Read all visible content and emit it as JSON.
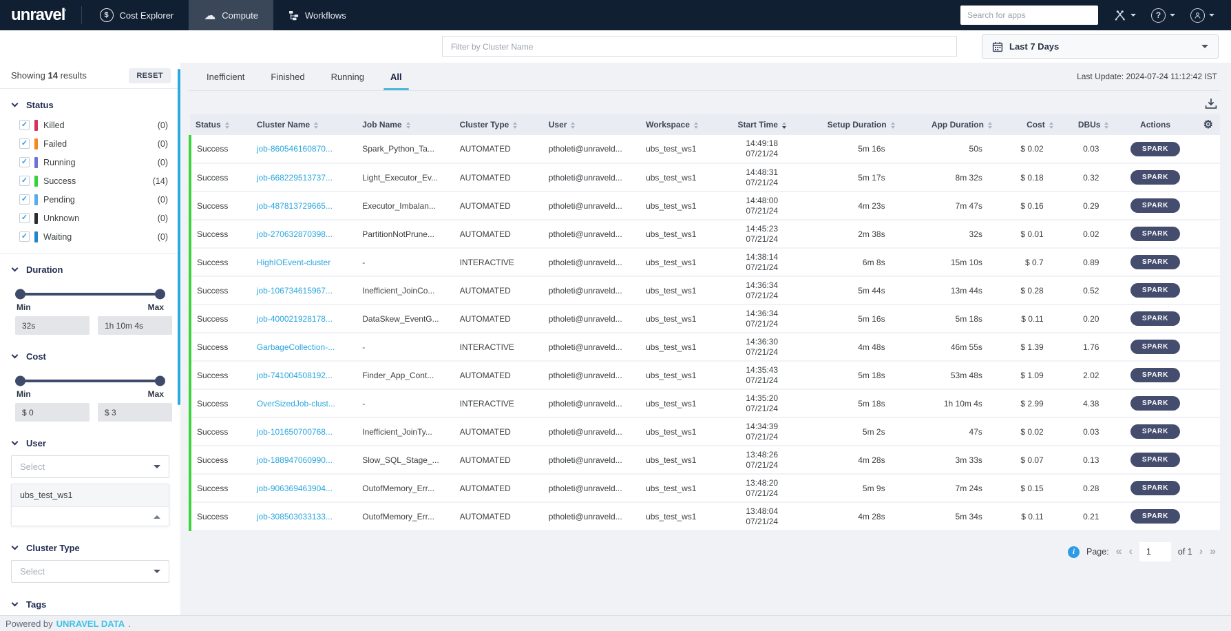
{
  "navbar": {
    "logo_text": "unravel",
    "items": [
      {
        "label": "Cost Explorer",
        "icon": "dollar-circle-icon"
      },
      {
        "label": "Compute",
        "icon": "compute-cloud-icon",
        "active": true
      },
      {
        "label": "Workflows",
        "icon": "workflows-icon"
      }
    ],
    "search_placeholder": "Search for apps"
  },
  "icons": {
    "dollar": "$",
    "cloud": "☁",
    "help": "?",
    "gear": "⚙",
    "check": "✓",
    "info": "i",
    "pagination_first": "«",
    "pagination_prev": "‹",
    "pagination_next": "›",
    "pagination_last": "»"
  },
  "filter_bar": {
    "cluster_filter_placeholder": "Filter by Cluster Name",
    "date_range": "Last 7 Days"
  },
  "sidebar": {
    "showing_prefix": "Showing",
    "result_count": "14",
    "showing_suffix": "results",
    "reset_label": "RESET",
    "status": {
      "title": "Status",
      "items": [
        {
          "label": "Killed",
          "count": "(0)",
          "color": "#d6325f"
        },
        {
          "label": "Failed",
          "count": "(0)",
          "color": "#f6871f"
        },
        {
          "label": "Running",
          "count": "(0)",
          "color": "#6b74d6"
        },
        {
          "label": "Success",
          "count": "(14)",
          "color": "#35d435"
        },
        {
          "label": "Pending",
          "count": "(0)",
          "color": "#5aabec"
        },
        {
          "label": "Unknown",
          "count": "(0)",
          "color": "#2b2b31"
        },
        {
          "label": "Waiting",
          "count": "(0)",
          "color": "#2186cd"
        }
      ]
    },
    "duration": {
      "title": "Duration",
      "min_label": "Min",
      "max_label": "Max",
      "min_value": "32s",
      "max_value": "1h 10m 4s"
    },
    "cost": {
      "title": "Cost",
      "min_label": "Min",
      "max_label": "Max",
      "min_value": "$ 0",
      "max_value": "$ 3"
    },
    "user": {
      "title": "User",
      "placeholder": "Select",
      "dropdown_item": "ubs_test_ws1"
    },
    "cluster_type": {
      "title": "Cluster Type",
      "placeholder": "Select"
    },
    "tags": {
      "title": "Tags"
    }
  },
  "main": {
    "tabs": [
      {
        "label": "Inefficient"
      },
      {
        "label": "Finished"
      },
      {
        "label": "Running"
      },
      {
        "label": "All",
        "active": true
      }
    ],
    "last_update": "Last Update: 2024-07-24 11:12:42 IST",
    "table": {
      "columns": [
        "Status",
        "Cluster Name",
        "Job Name",
        "Cluster Type",
        "User",
        "Workspace",
        "Start Time",
        "Setup Duration",
        "App Duration",
        "Cost",
        "DBUs",
        "Actions"
      ],
      "rows": [
        {
          "status": "Success",
          "cluster_name": "job-860546160870...",
          "job_name": "Spark_Python_Ta...",
          "cluster_type": "AUTOMATED",
          "user": "ptholeti@unraveld...",
          "workspace": "ubs_test_ws1",
          "start_time": "14:49:18",
          "start_date": "07/21/24",
          "setup_duration": "5m 16s",
          "app_duration": "50s",
          "cost": "$ 0.02",
          "dbus": "0.03",
          "action": "SPARK"
        },
        {
          "status": "Success",
          "cluster_name": "job-668229513737...",
          "job_name": "Light_Executor_Ev...",
          "cluster_type": "AUTOMATED",
          "user": "ptholeti@unraveld...",
          "workspace": "ubs_test_ws1",
          "start_time": "14:48:31",
          "start_date": "07/21/24",
          "setup_duration": "5m 17s",
          "app_duration": "8m 32s",
          "cost": "$ 0.18",
          "dbus": "0.32",
          "action": "SPARK"
        },
        {
          "status": "Success",
          "cluster_name": "job-487813729665...",
          "job_name": "Executor_Imbalan...",
          "cluster_type": "AUTOMATED",
          "user": "ptholeti@unraveld...",
          "workspace": "ubs_test_ws1",
          "start_time": "14:48:00",
          "start_date": "07/21/24",
          "setup_duration": "4m 23s",
          "app_duration": "7m 47s",
          "cost": "$ 0.16",
          "dbus": "0.29",
          "action": "SPARK"
        },
        {
          "status": "Success",
          "cluster_name": "job-270632870398...",
          "job_name": "PartitionNotPrune...",
          "cluster_type": "AUTOMATED",
          "user": "ptholeti@unraveld...",
          "workspace": "ubs_test_ws1",
          "start_time": "14:45:23",
          "start_date": "07/21/24",
          "setup_duration": "2m 38s",
          "app_duration": "32s",
          "cost": "$ 0.01",
          "dbus": "0.02",
          "action": "SPARK"
        },
        {
          "status": "Success",
          "cluster_name": "HighIOEvent-cluster",
          "job_name": "-",
          "cluster_type": "INTERACTIVE",
          "user": "ptholeti@unraveld...",
          "workspace": "ubs_test_ws1",
          "start_time": "14:38:14",
          "start_date": "07/21/24",
          "setup_duration": "6m 8s",
          "app_duration": "15m 10s",
          "cost": "$ 0.7",
          "dbus": "0.89",
          "action": "SPARK"
        },
        {
          "status": "Success",
          "cluster_name": "job-106734615967...",
          "job_name": "Inefficient_JoinCo...",
          "cluster_type": "AUTOMATED",
          "user": "ptholeti@unraveld...",
          "workspace": "ubs_test_ws1",
          "start_time": "14:36:34",
          "start_date": "07/21/24",
          "setup_duration": "5m 44s",
          "app_duration": "13m 44s",
          "cost": "$ 0.28",
          "dbus": "0.52",
          "action": "SPARK"
        },
        {
          "status": "Success",
          "cluster_name": "job-400021928178...",
          "job_name": "DataSkew_EventG...",
          "cluster_type": "AUTOMATED",
          "user": "ptholeti@unraveld...",
          "workspace": "ubs_test_ws1",
          "start_time": "14:36:34",
          "start_date": "07/21/24",
          "setup_duration": "5m 16s",
          "app_duration": "5m 18s",
          "cost": "$ 0.11",
          "dbus": "0.20",
          "action": "SPARK"
        },
        {
          "status": "Success",
          "cluster_name": "GarbageCollection-...",
          "job_name": "-",
          "cluster_type": "INTERACTIVE",
          "user": "ptholeti@unraveld...",
          "workspace": "ubs_test_ws1",
          "start_time": "14:36:30",
          "start_date": "07/21/24",
          "setup_duration": "4m 48s",
          "app_duration": "46m 55s",
          "cost": "$ 1.39",
          "dbus": "1.76",
          "action": "SPARK"
        },
        {
          "status": "Success",
          "cluster_name": "job-741004508192...",
          "job_name": "Finder_App_Cont...",
          "cluster_type": "AUTOMATED",
          "user": "ptholeti@unraveld...",
          "workspace": "ubs_test_ws1",
          "start_time": "14:35:43",
          "start_date": "07/21/24",
          "setup_duration": "5m 18s",
          "app_duration": "53m 48s",
          "cost": "$ 1.09",
          "dbus": "2.02",
          "action": "SPARK"
        },
        {
          "status": "Success",
          "cluster_name": "OverSizedJob-clust...",
          "job_name": "-",
          "cluster_type": "INTERACTIVE",
          "user": "ptholeti@unraveld...",
          "workspace": "ubs_test_ws1",
          "start_time": "14:35:20",
          "start_date": "07/21/24",
          "setup_duration": "5m 18s",
          "app_duration": "1h 10m 4s",
          "cost": "$ 2.99",
          "dbus": "4.38",
          "action": "SPARK"
        },
        {
          "status": "Success",
          "cluster_name": "job-101650700768...",
          "job_name": "Inefficient_JoinTy...",
          "cluster_type": "AUTOMATED",
          "user": "ptholeti@unraveld...",
          "workspace": "ubs_test_ws1",
          "start_time": "14:34:39",
          "start_date": "07/21/24",
          "setup_duration": "5m 2s",
          "app_duration": "47s",
          "cost": "$ 0.02",
          "dbus": "0.03",
          "action": "SPARK"
        },
        {
          "status": "Success",
          "cluster_name": "job-188947060990...",
          "job_name": "Slow_SQL_Stage_...",
          "cluster_type": "AUTOMATED",
          "user": "ptholeti@unraveld...",
          "workspace": "ubs_test_ws1",
          "start_time": "13:48:26",
          "start_date": "07/21/24",
          "setup_duration": "4m 28s",
          "app_duration": "3m 33s",
          "cost": "$ 0.07",
          "dbus": "0.13",
          "action": "SPARK"
        },
        {
          "status": "Success",
          "cluster_name": "job-906369463904...",
          "job_name": "OutofMemory_Err...",
          "cluster_type": "AUTOMATED",
          "user": "ptholeti@unraveld...",
          "workspace": "ubs_test_ws1",
          "start_time": "13:48:20",
          "start_date": "07/21/24",
          "setup_duration": "5m 9s",
          "app_duration": "7m 24s",
          "cost": "$ 0.15",
          "dbus": "0.28",
          "action": "SPARK"
        },
        {
          "status": "Success",
          "cluster_name": "job-308503033133...",
          "job_name": "OutofMemory_Err...",
          "cluster_type": "AUTOMATED",
          "user": "ptholeti@unraveld...",
          "workspace": "ubs_test_ws1",
          "start_time": "13:48:04",
          "start_date": "07/21/24",
          "setup_duration": "4m 28s",
          "app_duration": "5m 34s",
          "cost": "$ 0.11",
          "dbus": "0.21",
          "action": "SPARK"
        }
      ]
    },
    "pagination": {
      "label": "Page:",
      "current": "1",
      "of_label": "of 1"
    }
  },
  "footer": {
    "prefix": "Powered by",
    "link": "UNRAVEL DATA",
    "suffix": "."
  },
  "colors": {
    "accent_blue": "#29abe2",
    "navbar_bg": "#101f31",
    "success_green": "#3ed33e",
    "spark_pill": "#454d6e",
    "tab_underline": "#4cb8d6"
  }
}
